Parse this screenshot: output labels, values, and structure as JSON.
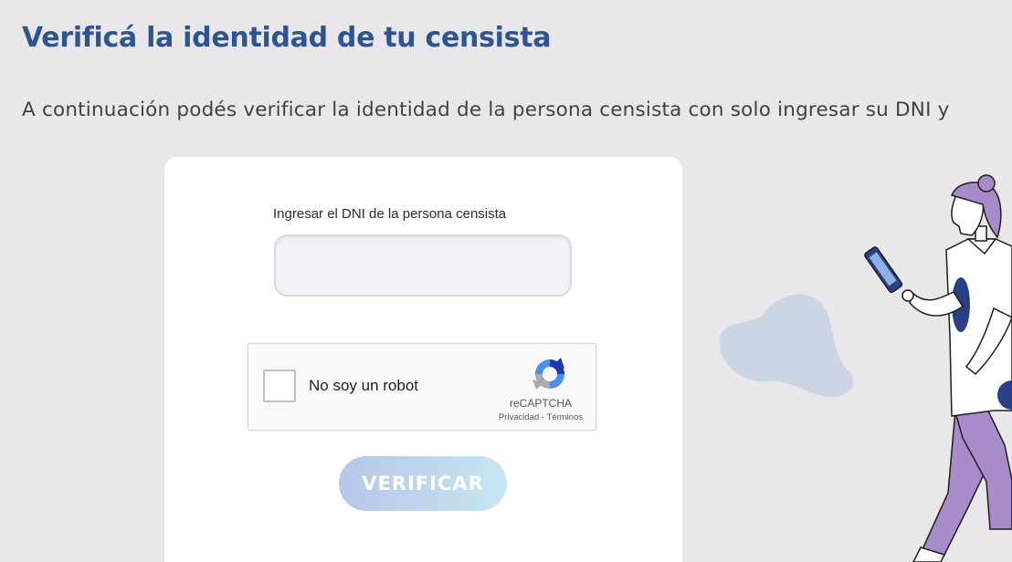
{
  "header": {
    "title": "Verificá la identidad de tu censista",
    "subtitle": "A continuación podés verificar la identidad de la persona censista con solo ingresar su DNI y"
  },
  "form": {
    "dni_label": "Ingresar el DNI de la persona censista",
    "dni_value": "",
    "dni_placeholder": "",
    "verify_button_label": "VERIFICAR"
  },
  "recaptcha": {
    "checkbox_label": "No soy un robot",
    "brand": "reCAPTCHA",
    "privacy_link": "Privacidad",
    "separator": " - ",
    "terms_link": "Términos",
    "icon": "recaptcha-logo-icon"
  },
  "decor": {
    "illustration": "census-worker-illustration",
    "blob": "decorative-blob"
  },
  "colors": {
    "background": "#e9e7e9",
    "title": "#2d5591",
    "card": "#ffffff",
    "button_gradient_start": "#b6c6e8",
    "button_gradient_end": "#c6e6f1",
    "blob": "#ccd5e6",
    "illustration_purple": "#a98bcc",
    "illustration_navy": "#2a3f86"
  }
}
